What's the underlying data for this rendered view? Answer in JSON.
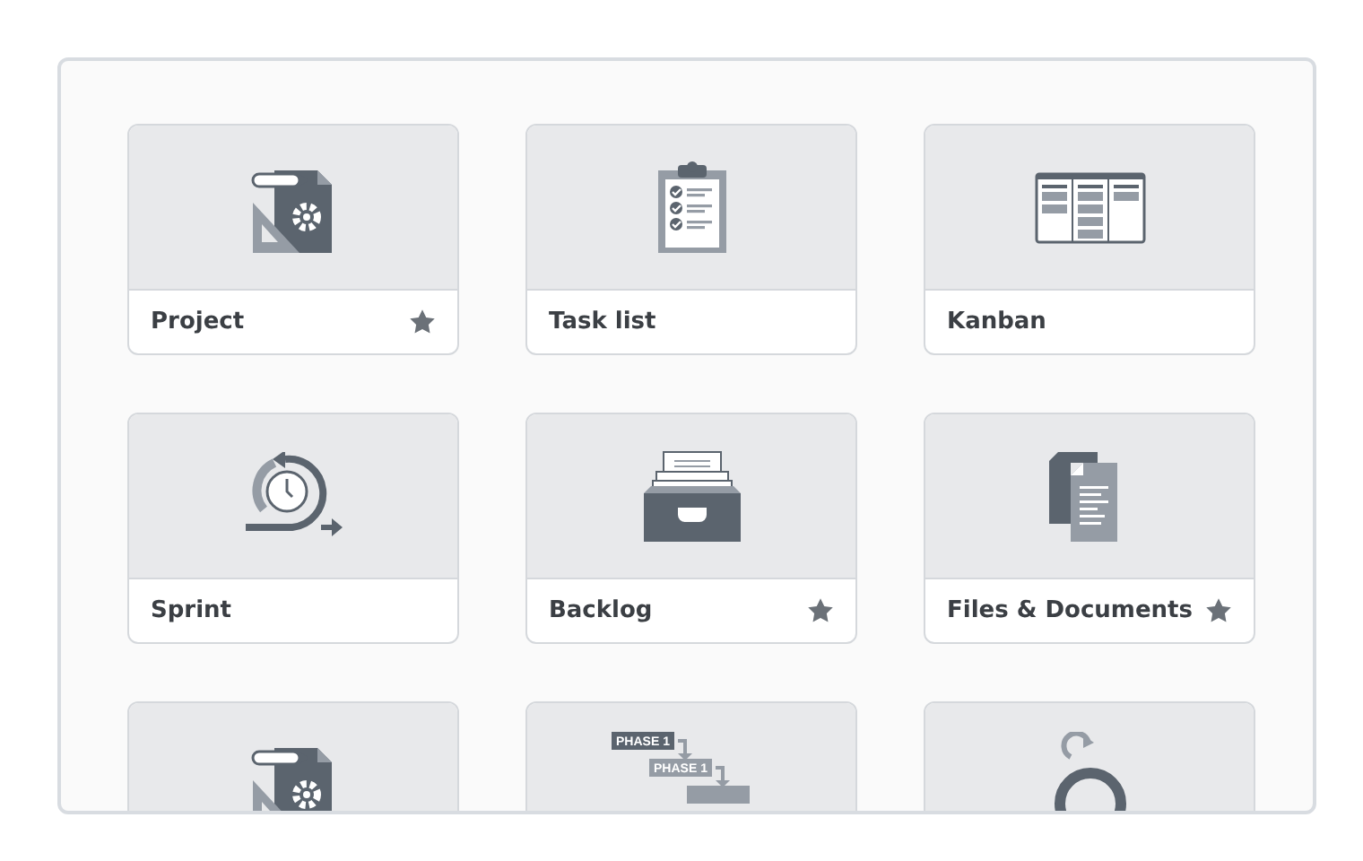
{
  "cards": [
    {
      "kind": "project",
      "label": "Project",
      "starred": true
    },
    {
      "kind": "tasklist",
      "label": "Task list",
      "starred": false
    },
    {
      "kind": "kanban",
      "label": "Kanban",
      "starred": false
    },
    {
      "kind": "sprint",
      "label": "Sprint",
      "starred": false
    },
    {
      "kind": "backlog",
      "label": "Backlog",
      "starred": true
    },
    {
      "kind": "files",
      "label": "Files & Documents",
      "starred": true
    },
    {
      "kind": "project"
    },
    {
      "kind": "phases",
      "phases": [
        "PHASE 1",
        "PHASE 1"
      ]
    },
    {
      "kind": "cycle"
    }
  ]
}
